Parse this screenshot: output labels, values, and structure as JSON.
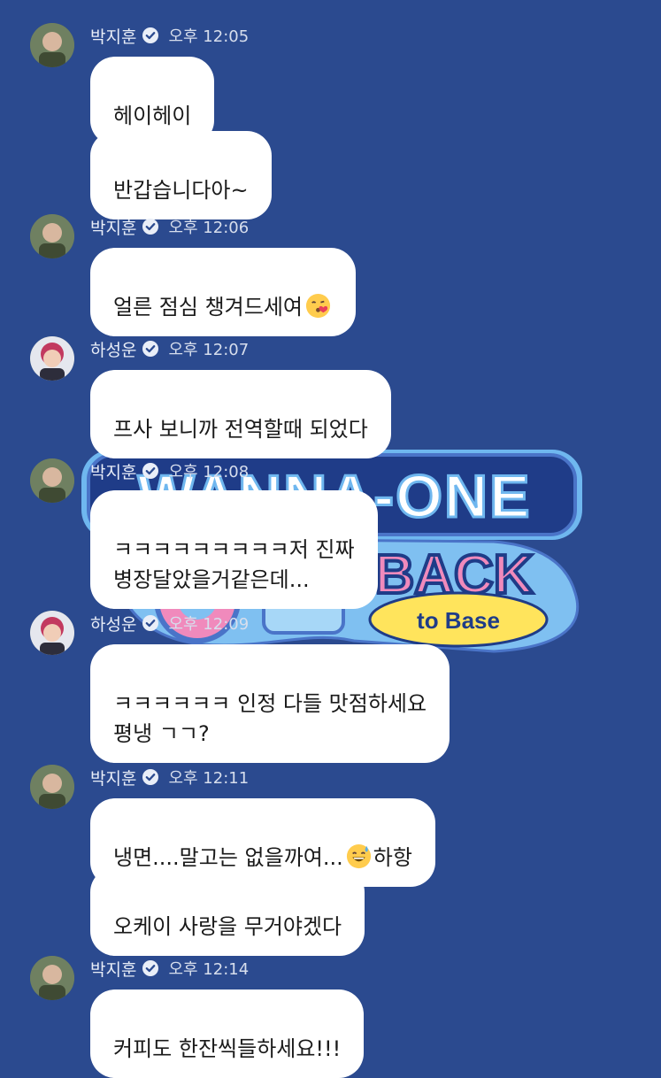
{
  "logo": {
    "top_text": "WANNA-ONE",
    "back_text": "BACK",
    "to_base_text": "to Base",
    "colors": {
      "navy": "#1f3c88",
      "outline": "#4a74c8",
      "pink": "#f08abc",
      "yellow": "#ffe45c"
    }
  },
  "theme": {
    "background": "#2b4a8f",
    "bubble": "#ffffff",
    "text": "#1a1a1a",
    "meta_text": "#e9eef8"
  },
  "messages": [
    {
      "sender": "박지훈",
      "avatar_icon": "profile-photo-park-jihoon",
      "verified_icon": "verified-check-icon",
      "time": "오후 12:05",
      "bubbles": [
        "헤이헤이",
        "반갑습니다아~"
      ]
    },
    {
      "sender": "박지훈",
      "avatar_icon": "profile-photo-park-jihoon",
      "verified_icon": "verified-check-icon",
      "time": "오후 12:06",
      "bubbles": [
        {
          "text": "얼른 점심 챙겨드세여",
          "emoji": "kissing-face-emoji"
        }
      ]
    },
    {
      "sender": "하성운",
      "avatar_icon": "profile-photo-ha-sungwoon",
      "verified_icon": "verified-check-icon",
      "time": "오후 12:07",
      "bubbles": [
        "프사 보니까 전역할때 되었다"
      ]
    },
    {
      "sender": "박지훈",
      "avatar_icon": "profile-photo-park-jihoon",
      "verified_icon": "verified-check-icon",
      "time": "오후 12:08",
      "bubbles": [
        "ㅋㅋㅋㅋㅋㅋㅋㅋㅋ저 진짜\n병장달았을거같은데..."
      ]
    },
    {
      "sender": "하성운",
      "avatar_icon": "profile-photo-ha-sungwoon",
      "verified_icon": "verified-check-icon",
      "time": "오후 12:09",
      "bubbles": [
        "ㅋㅋㅋㅋㅋㅋ 인정 다들 맛점하세요\n평냉 ㄱㄱ?"
      ]
    },
    {
      "sender": "박지훈",
      "avatar_icon": "profile-photo-park-jihoon",
      "verified_icon": "verified-check-icon",
      "time": "오후 12:11",
      "bubbles": [
        {
          "text_before": "냉면....말고는 없을까여...",
          "emoji": "grinning-sweat-emoji",
          "text_after": "하항"
        },
        "오케이 사랑을 무거야겠다"
      ]
    },
    {
      "sender": "박지훈",
      "avatar_icon": "profile-photo-park-jihoon",
      "verified_icon": "verified-check-icon",
      "time": "오후 12:14",
      "bubbles": [
        "커피도 한잔씩들하세요!!!"
      ]
    }
  ]
}
